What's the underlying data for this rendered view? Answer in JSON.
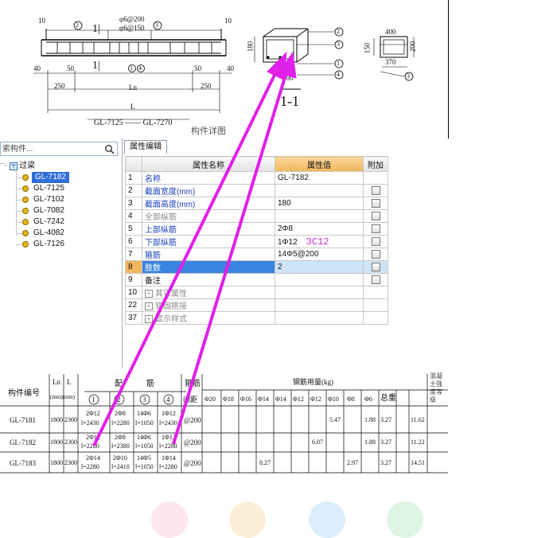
{
  "drawing": {
    "title_span": "GL-7125 —— GL-7270",
    "section_label": "1-1",
    "section_mark": "1|",
    "dim_top_1": "φ6@200",
    "dim_top_2": "φ6@150",
    "dim_10_left": "10",
    "dim_10_right": "10",
    "dim_40_left": "40",
    "dim_50": "50",
    "dim_1_marker": "1|",
    "dim_250_left": "250",
    "dim_250_right": "250",
    "dim_ln": "Ln",
    "dim_l": "L",
    "dim_50_right": "50",
    "dim_40_right": "40",
    "dim_180": "180",
    "dim_150": "150",
    "dim_400": "400",
    "dim_200": "200",
    "dim_370": "370",
    "dim_200_bottom": "200",
    "circle_labels": [
      "2",
      "3",
      "1",
      "4",
      "3",
      "1",
      "4",
      "2",
      "3"
    ],
    "partial_caption": "构件详图"
  },
  "search": {
    "placeholder": "索构件..."
  },
  "tree": {
    "root_label": "过梁",
    "items": [
      {
        "label": "GL-7182",
        "selected": true
      },
      {
        "label": "GL-7125",
        "selected": false
      },
      {
        "label": "GL-7102",
        "selected": false
      },
      {
        "label": "GL-7082",
        "selected": false
      },
      {
        "label": "GL-7242",
        "selected": false
      },
      {
        "label": "GL-4082",
        "selected": false
      },
      {
        "label": "GL-7126",
        "selected": false
      }
    ]
  },
  "property_editor": {
    "tab_label": "属性编辑",
    "headers": {
      "name": "属性名称",
      "value": "属性值",
      "add": "附加"
    },
    "rows": [
      {
        "num": "1",
        "name": "名称",
        "value": "GL-7182",
        "style": "blue",
        "check": false
      },
      {
        "num": "2",
        "name": "截面宽度(mm)",
        "value": "",
        "style": "blue",
        "check": true
      },
      {
        "num": "3",
        "name": "截面高度(mm)",
        "value": "180",
        "style": "blue",
        "check": true
      },
      {
        "num": "4",
        "name": "全部纵筋",
        "value": "",
        "style": "gray",
        "check": true
      },
      {
        "num": "5",
        "name": "上部纵筋",
        "value": "2Φ8",
        "style": "blue",
        "check": true
      },
      {
        "num": "6",
        "name": "下部纵筋",
        "value": "1Φ12",
        "style": "blue",
        "check": true
      },
      {
        "num": "7",
        "name": "箍筋",
        "value": "14Φ5@200",
        "style": "blue",
        "check": true
      },
      {
        "num": "8",
        "name": "肢数",
        "value": "2",
        "style": "selected",
        "check": true
      },
      {
        "num": "9",
        "name": "备注",
        "value": "",
        "style": "normal",
        "check": true
      },
      {
        "num": "10",
        "name": "其它属性",
        "value": "",
        "style": "group",
        "check": false
      },
      {
        "num": "22",
        "name": "锚固搭接",
        "value": "",
        "style": "group",
        "check": false
      },
      {
        "num": "37",
        "name": "显示样式",
        "value": "",
        "style": "group",
        "check": false
      }
    ],
    "annotation": "3C12"
  },
  "rebar_table": {
    "col_id": "构件编号",
    "col_ln": "Ln",
    "col_l": "L",
    "col_unit": "(mm)(mm)",
    "col_pei": "配",
    "col_jin": "筋",
    "col_gujin": "箍筋",
    "col_jianju": "间距",
    "col_steel": "钢筋用量(kg)",
    "col_strength": "混凝土强度等级",
    "circle_nums": [
      "1",
      "2",
      "3",
      "4"
    ],
    "bar_sizes": [
      "Φ20",
      "Φ18",
      "Φ16",
      "Φ14",
      "Φ14",
      "Φ12",
      "Φ12",
      "Φ10",
      "Φ8",
      "Φ6",
      "总重"
    ],
    "rows": [
      {
        "id": "GL-7181",
        "ln": "1800",
        "l": "2300",
        "c1": "2Φ12",
        "c1b": "l=2430",
        "c2": "2Φ8",
        "c2b": "l=2280",
        "c3": "14Φ6",
        "c3b": "l=1050",
        "c4": "1Φ12",
        "c4b": "l=2430",
        "sp": "@200",
        "w1": "5.47",
        "w2": "1.88",
        "w3": "3.27",
        "w4": "11.62"
      },
      {
        "id": "GL-7182",
        "ln": "1800",
        "l": "2300",
        "c1": "2Φ12",
        "c1b": "l=2280",
        "c2": "2Φ8",
        "c2b": "l=2380",
        "c3": "14Φ6",
        "c3b": "l=1050",
        "c4": "1Φ12",
        "c4b": "l=2280",
        "sp": "@200",
        "w1": "6.07",
        "w2": "1.88",
        "w3": "3.27",
        "w4": "11.22"
      },
      {
        "id": "GL-7183",
        "ln": "1800",
        "l": "2300",
        "c1": "2Φ14",
        "c1b": "l=2280",
        "c2": "2Φ10",
        "c2b": "l=2410",
        "c3": "14Φ5",
        "c3b": "l=1050",
        "c4": "1Φ14",
        "c4b": "l=2280",
        "sp": "@200",
        "w1": "8.27",
        "w2": "2.97",
        "w3": "3.27",
        "w4": "14.51"
      }
    ]
  },
  "colors": {
    "arrow": "#e020e8",
    "selection": "#2f6fd6",
    "value_header": "#f2b65c"
  }
}
